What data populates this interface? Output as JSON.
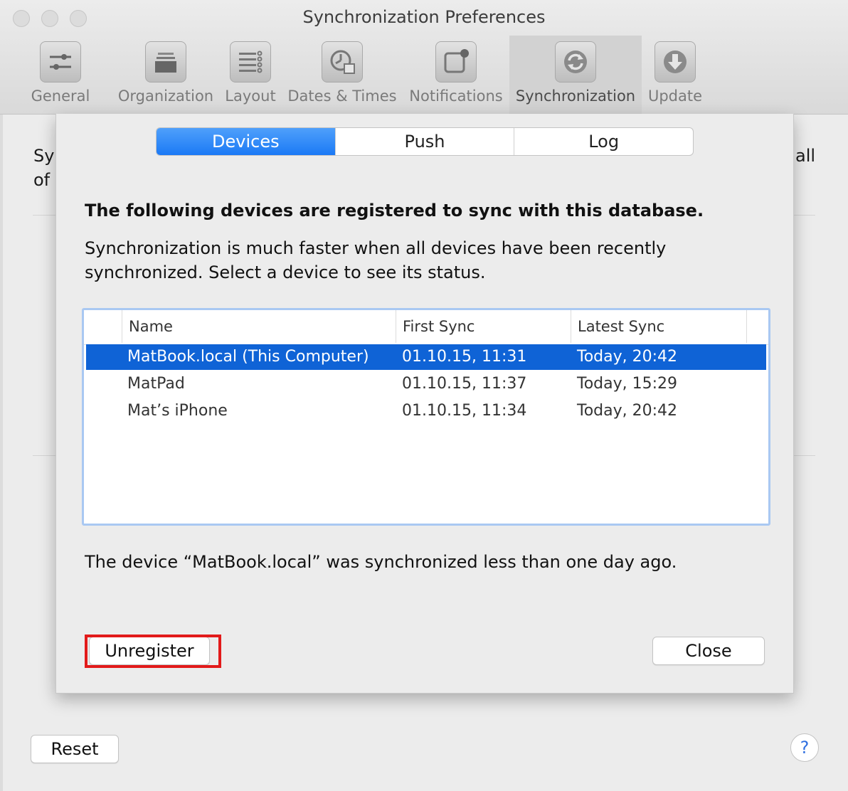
{
  "window": {
    "title": "Synchronization Preferences"
  },
  "toolbar": {
    "items": [
      {
        "label": "General",
        "icon": "sliders-icon"
      },
      {
        "label": "Organization",
        "icon": "tray-stack-icon"
      },
      {
        "label": "Layout",
        "icon": "list-layout-icon"
      },
      {
        "label": "Dates & Times",
        "icon": "clock-calendar-icon"
      },
      {
        "label": "Notifications",
        "icon": "notification-badge-icon"
      },
      {
        "label": "Synchronization",
        "icon": "sync-arrows-icon",
        "active": true
      },
      {
        "label": "Update",
        "icon": "download-arrow-icon"
      }
    ]
  },
  "background": {
    "text_left_1": "Sy",
    "text_left_2": "of",
    "text_right_1": "all"
  },
  "sheet": {
    "segments": [
      "Devices",
      "Push",
      "Log"
    ],
    "selected_segment": "Devices",
    "heading": "The following devices are registered to sync with this database.",
    "description": "Synchronization is much faster when all devices have been recently synchronized. Select a device to see its status.",
    "table": {
      "columns": [
        "Name",
        "First Sync",
        "Latest Sync"
      ],
      "rows": [
        {
          "name": "MatBook.local (This Computer)",
          "first_sync": "01.10.15, 11:31",
          "latest_sync": "Today, 20:42",
          "selected": true
        },
        {
          "name": "MatPad",
          "first_sync": "01.10.15, 11:37",
          "latest_sync": "Today, 15:29"
        },
        {
          "name": "Mat’s iPhone",
          "first_sync": "01.10.15, 11:34",
          "latest_sync": "Today, 20:42"
        }
      ]
    },
    "status": "The device “MatBook.local” was synchronized less than one day ago.",
    "unregister_label": "Unregister",
    "close_label": "Close"
  },
  "footer": {
    "reset_label": "Reset",
    "help_label": "?"
  },
  "colors": {
    "accent": "#1b79f5",
    "selection": "#0f63d6",
    "highlight": "#e21a1a"
  }
}
